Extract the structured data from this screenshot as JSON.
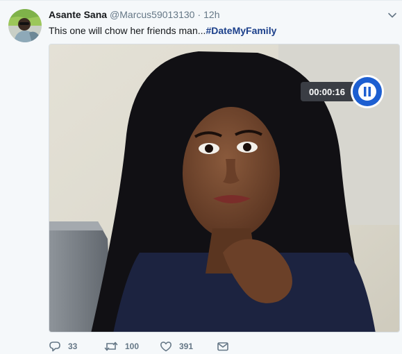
{
  "tweet": {
    "author_name": "Asante Sana",
    "author_handle": "@Marcus59013130",
    "separator": "·",
    "timestamp": "12h",
    "text": "This one will chow her friends man...",
    "hashtag": "#DateMyFamily",
    "avatar_icon": "avatar-photo",
    "more_icon": "chevron-down-icon",
    "media": {
      "description_icon": "photo-of-tv-screen",
      "timer_readout": "00:00:16",
      "timer_icon": "pause-icon"
    },
    "actions": {
      "reply_icon": "reply-icon",
      "reply_count": "33",
      "retweet_icon": "retweet-icon",
      "retweet_count": "100",
      "like_icon": "heart-icon",
      "like_count": "391",
      "dm_icon": "envelope-icon"
    }
  },
  "colors": {
    "background": "#f5f8fa",
    "text": "#14171a",
    "muted": "#657786",
    "hashtag": "#1b3f8a",
    "timer_ring": "#1d5fd1"
  }
}
